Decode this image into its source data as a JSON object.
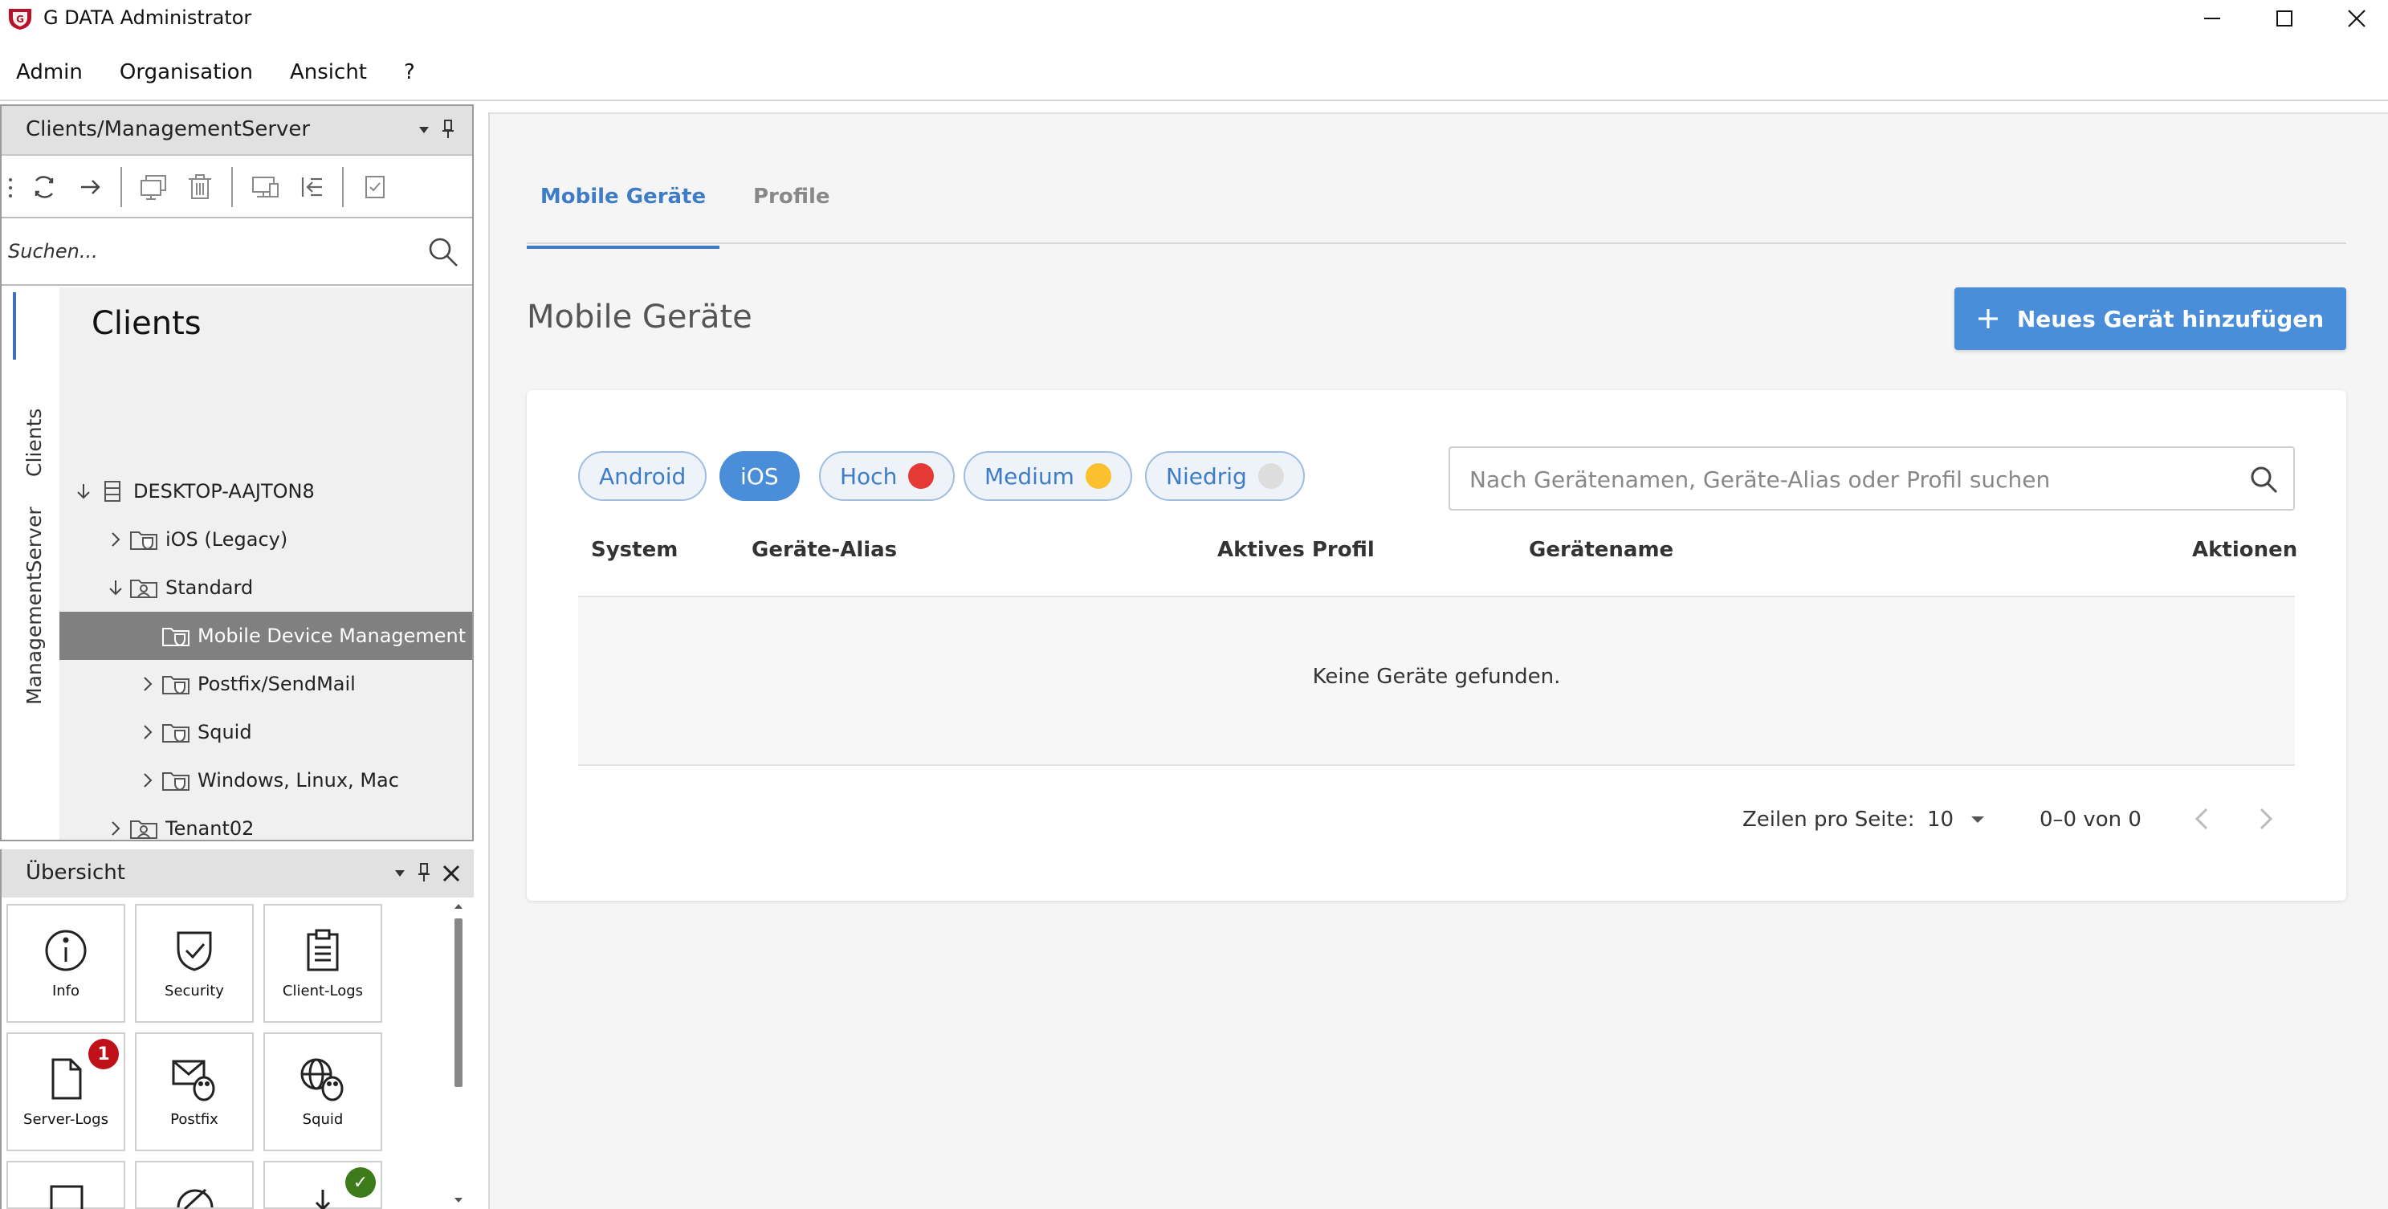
{
  "window": {
    "title": "G DATA Administrator"
  },
  "menu": [
    "Admin",
    "Organisation",
    "Ansicht",
    "?"
  ],
  "left_panel": {
    "title": "Clients/ManagementServer",
    "search_placeholder": "Suchen...",
    "vertical_tabs": [
      "Clients",
      "ManagementServer"
    ],
    "tree_title": "Clients",
    "tree": [
      {
        "label": "DESKTOP-AAJTON8",
        "expanded": true
      },
      {
        "label": "iOS (Legacy)"
      },
      {
        "label": "Standard",
        "expanded": true
      },
      {
        "label": "Mobile Device Management",
        "selected": true
      },
      {
        "label": "Postfix/SendMail"
      },
      {
        "label": "Squid"
      },
      {
        "label": "Windows, Linux, Mac"
      },
      {
        "label": "Tenant02"
      }
    ]
  },
  "overview": {
    "title": "Übersicht",
    "tiles": [
      {
        "label": "Info",
        "icon": "info-icon"
      },
      {
        "label": "Security",
        "icon": "shield-icon"
      },
      {
        "label": "Client-Logs",
        "icon": "clipboard-icon"
      },
      {
        "label": "Server-Logs",
        "icon": "document-icon",
        "badge": "1"
      },
      {
        "label": "Postfix",
        "icon": "mail-penguin-icon"
      },
      {
        "label": "Squid",
        "icon": "globe-penguin-icon"
      }
    ]
  },
  "main": {
    "tabs": [
      "Mobile Geräte",
      "Profile"
    ],
    "title": "Mobile Geräte",
    "add_button": "Neues Gerät hinzufügen",
    "filters": [
      {
        "label": "Android",
        "active": false
      },
      {
        "label": "iOS",
        "active": true
      },
      {
        "label": "Hoch",
        "dot": "#e53935"
      },
      {
        "label": "Medium",
        "dot": "#fbc02d"
      },
      {
        "label": "Niedrig",
        "dot": "#dddddd"
      }
    ],
    "search_placeholder": "Nach Gerätenamen, Geräte-Alias oder Profil suchen",
    "columns": [
      "System",
      "Geräte-Alias",
      "Aktives Profil",
      "Gerätename",
      "Aktionen"
    ],
    "empty_message": "Keine Geräte gefunden.",
    "pagination": {
      "rows_label": "Zeilen pro Seite:",
      "rows_value": "10",
      "range": "0–0 von 0"
    }
  },
  "colors": {
    "accent": "#4a8dd8",
    "selected_row": "#808080",
    "badge_red": "#c0101a",
    "badge_green": "#3d7a1a"
  }
}
